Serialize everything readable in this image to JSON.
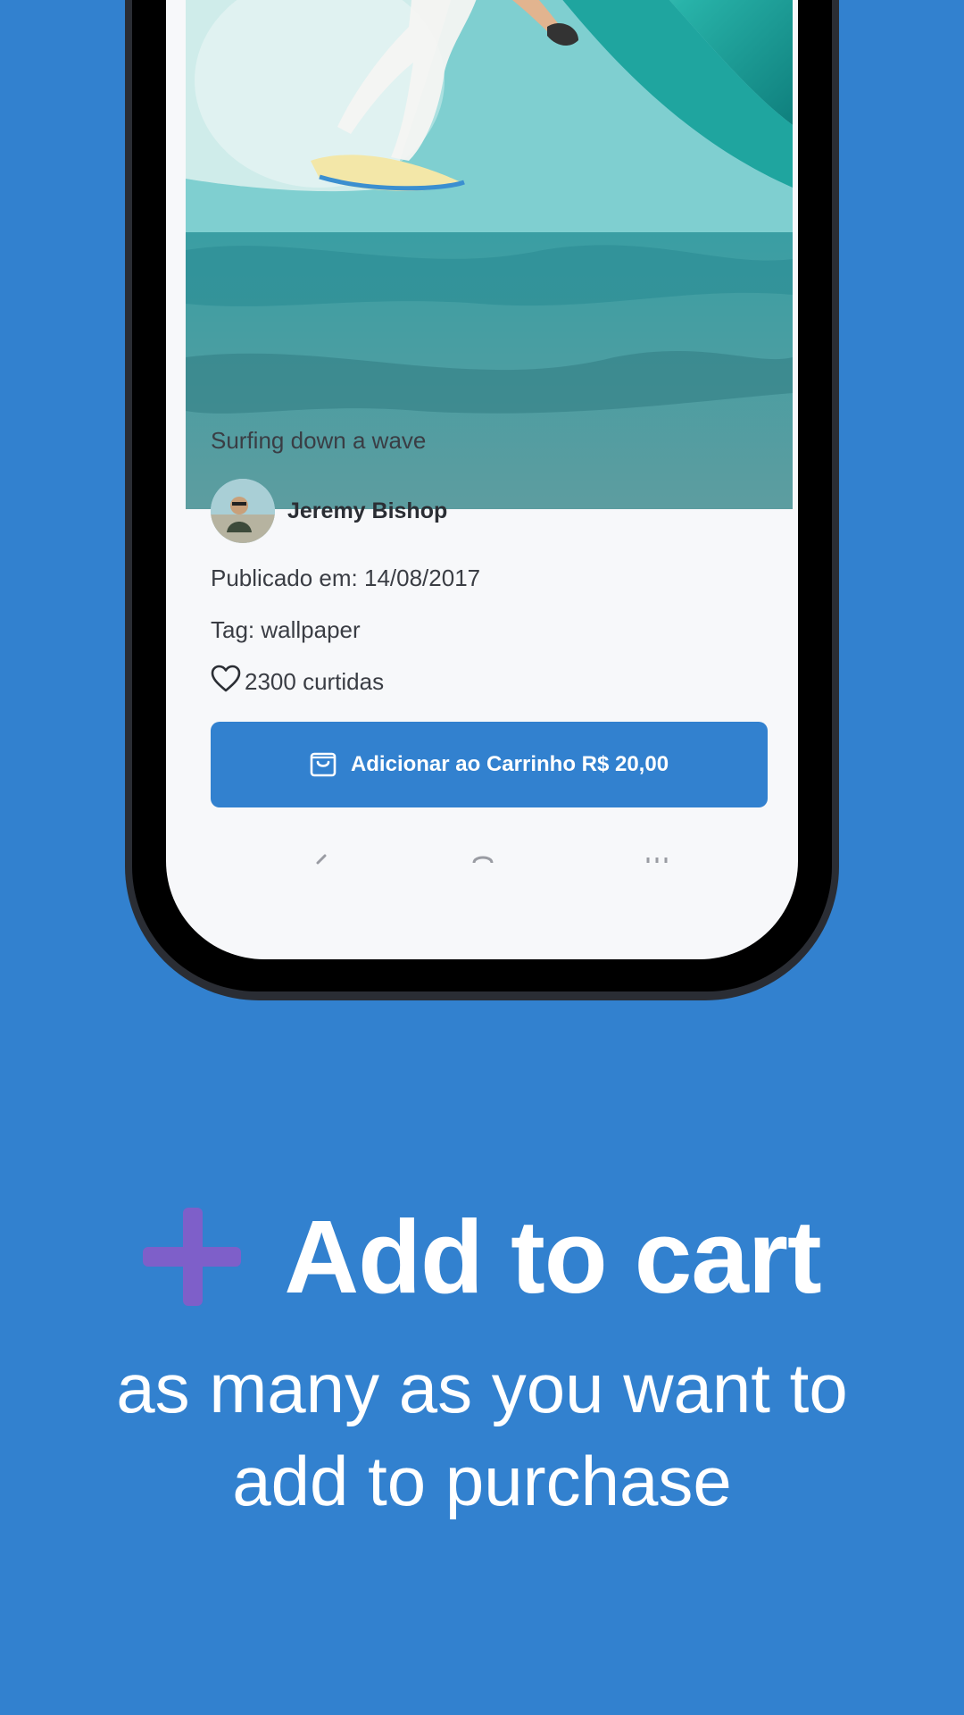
{
  "product": {
    "caption": "Surfing down a wave",
    "author_name": "Jeremy Bishop",
    "published": "Publicado em: 14/08/2017",
    "tag": "Tag: wallpaper",
    "likes": "2300 curtidas",
    "cart_button_label": "Adicionar ao Carrinho R$ 20,00"
  },
  "promo": {
    "headline": "Add to cart",
    "subline_line1": "as many as you want to",
    "subline_line2": "add to purchase"
  },
  "colors": {
    "background": "#3281cf",
    "button": "#3281cf",
    "plus_accent": "#7e5fc9"
  },
  "icons": {
    "plus": "plus-icon",
    "heart": "heart-icon",
    "bag": "shopping-bag-icon"
  }
}
